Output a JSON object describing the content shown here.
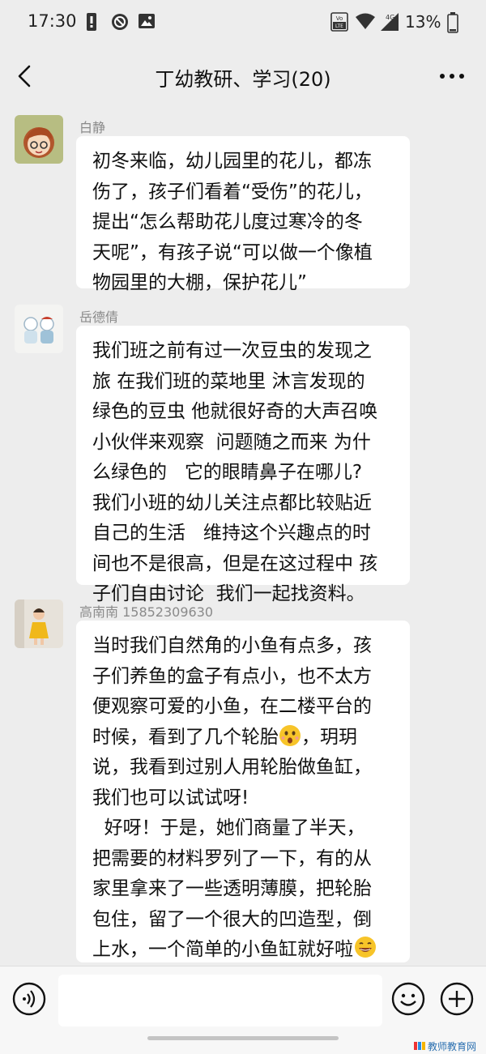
{
  "status": {
    "time": "17:30",
    "network": "4G",
    "battery": "13%"
  },
  "header": {
    "title": "丁幼教研、学习(20)"
  },
  "messages": [
    {
      "sender": "白静",
      "lines": [
        "初冬来临，幼儿园里的花儿，都冻",
        "伤了，孩子们看着“受伤”的花儿，",
        "提出“怎么帮助花儿度过寒冷的冬",
        "天呢”，有孩子说“可以做一个像植",
        "物园里的大棚，保护花儿”"
      ]
    },
    {
      "sender": "岳德倩",
      "lines": [
        "我们班之前有过一次豆虫的发现之",
        "旅 在我们班的菜地里 沐言发现的",
        "绿色的豆虫 他就很好奇的大声召唤",
        "小伙伴来观察  问题随之而来 为什",
        "么绿色的   它的眼睛鼻子在哪儿?",
        "我们小班的幼儿关注点都比较贴近",
        "自己的生活   维持这个兴趣点的时",
        "间也不是很高，但是在这过程中 孩",
        "子们自由讨论  我们一起找资料。"
      ]
    },
    {
      "sender": "高南南 15852309630",
      "lines": [
        "当时我们自然角的小鱼有点多，孩",
        "子们养鱼的盒子有点小，也不太方",
        "便观察可爱的小鱼，在二楼平台的",
        "时候，看到了几个轮胎",
        "，玥玥",
        "说，我看到过别人用轮胎做鱼缸，",
        "我们也可以试试呀!",
        "  好呀！于是，她们商量了半天，",
        "把需要的材料罗列了一下，有的从",
        "家里拿来了一些透明薄膜，把轮胎",
        "包住，留了一个很大的凹造型，倒",
        "上水，一个简单的小鱼缸就好啦"
      ]
    }
  ],
  "icons": {
    "surprised_emoji": "surprised-face-emoji",
    "grin_emoji": "grinning-face-emoji"
  },
  "watermark": "教师教育网"
}
